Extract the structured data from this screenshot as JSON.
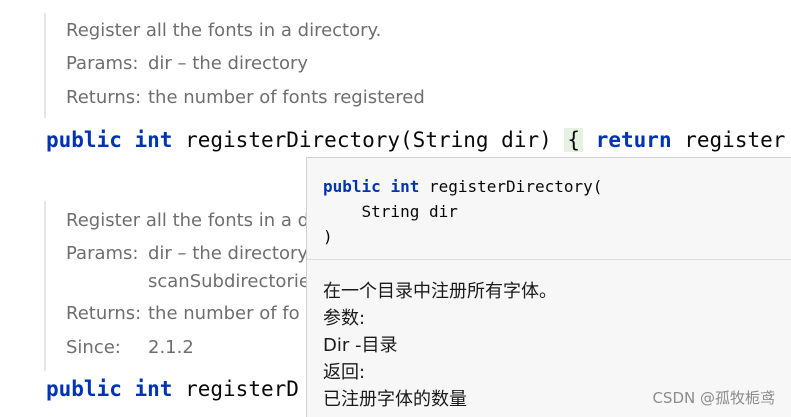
{
  "doc1": {
    "summary": "Register all the fonts in a directory.",
    "params_label": "Params:",
    "params_value": "dir – the directory",
    "returns_label": "Returns:",
    "returns_value": "the number of fonts registered"
  },
  "code1": {
    "kw_public": "public",
    "kw_int": "int",
    "method": "registerDirectory(String dir)",
    "brace": "{",
    "kw_return": "return",
    "rest": "register"
  },
  "doc2": {
    "summary": "Register all the fonts in a d",
    "params_label": "Params:",
    "params_value": "dir – the directory",
    "params_value2": "scanSubdirectorie",
    "returns_label": "Returns:",
    "returns_value": "the number of fo",
    "since_label": "Since:",
    "since_value": "2.1.2"
  },
  "code2": {
    "kw_public": "public",
    "kw_int": "int",
    "method": "registerD"
  },
  "popup": {
    "sig_kw_public": "public",
    "sig_kw_int": "int",
    "sig_line1": "registerDirectory(",
    "sig_line2": "    String dir",
    "sig_line3": ")",
    "desc_line1": "在一个目录中注册所有字体。",
    "desc_line2": "参数:",
    "desc_line3": "Dir -目录",
    "desc_line4": "返回:",
    "desc_line5": "已注册字体的数量"
  },
  "watermark": "CSDN @孤牧栀鸢",
  "colors": {
    "keyword": "#0033b3",
    "doc_text": "#6e6e6e",
    "brace_highlight": "#e6f1e2",
    "popup_bg": "#f7f7f7"
  }
}
